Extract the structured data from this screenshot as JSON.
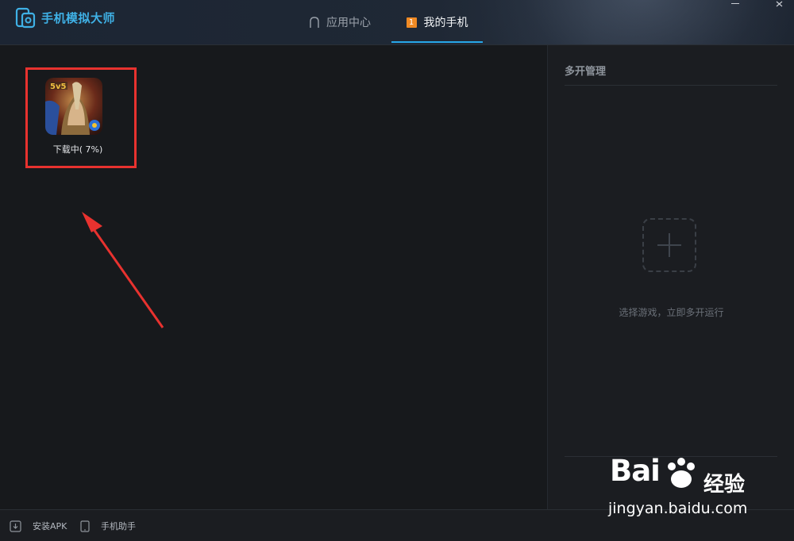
{
  "window": {
    "app_title": "手机模拟大师",
    "tabs": [
      {
        "label": "应用中心",
        "active": false,
        "icon": "home-icon"
      },
      {
        "label": "我的手机",
        "active": true,
        "badge": "1"
      }
    ],
    "controls": {
      "minimize": "minimize-icon",
      "close": "close-icon"
    }
  },
  "apps": [
    {
      "status": "下载中( 7%)",
      "progress_percent": 7,
      "icon": "game-app-icon"
    }
  ],
  "multi_open": {
    "title": "多开管理",
    "hint": "选择游戏，立即多开运行"
  },
  "bottom_bar": {
    "install_apk": "安装APK",
    "phone_helper": "手机助手"
  },
  "watermark": {
    "brand": "Bai",
    "brand_suffix": "经验",
    "url": "jingyan.baidu.com"
  },
  "colors": {
    "accent": "#27a7e8",
    "badge": "#f08a24",
    "highlight_box": "#e8322f"
  }
}
